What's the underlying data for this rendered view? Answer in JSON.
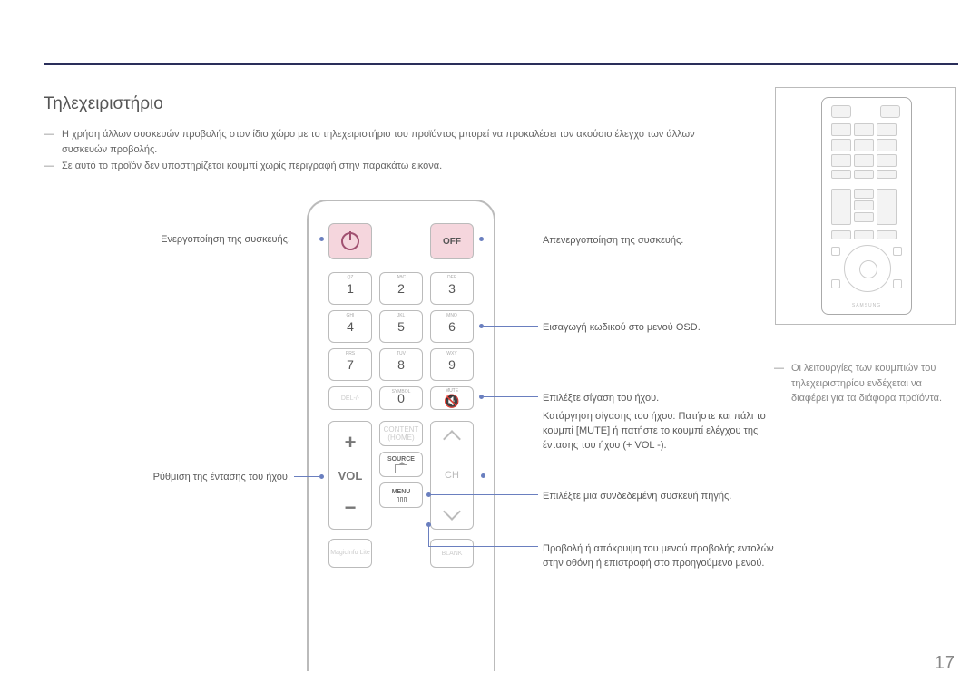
{
  "title": "Τηλεχειριστήριο",
  "notes": {
    "n1": "Η χρήση άλλων συσκευών προβολής στον ίδιο χώρο με το τηλεχειριστήριο του προϊόντος μπορεί να προκαλέσει τον ακούσιο έλεγχο των άλλων συσκευών προβολής.",
    "n2": "Σε αυτό το προϊόν δεν υποστηρίζεται κουμπί χωρίς περιγραφή στην παρακάτω εικόνα."
  },
  "right_note": "Οι λειτουργίες των κουμπιών του τηλεχειριστηρίου ενδέχεται να διαφέρει για τα διάφορα προϊόντα.",
  "left_labels": {
    "power_on": "Ενεργοποίηση της συσκευής.",
    "volume": "Ρύθμιση της έντασης του ήχου."
  },
  "right_labels": {
    "power_off": "Απενεργοποίηση της συσκευής.",
    "osd_code": "Εισαγωγή κωδικού στο μενού OSD.",
    "mute": "Επιλέξτε σίγαση του ήχου.",
    "unmute": "Κατάργηση σίγασης του ήχου: Πατήστε και πάλι το κουμπί [MUTE] ή πατήστε το κουμπί ελέγχου της έντασης του ήχου (+ VOL -).",
    "source": "Επιλέξτε μια συνδεδεμένη συσκευή πηγής.",
    "menu": "Προβολή ή απόκρυψη του μενού προβολής εντολών στην οθόνη ή επιστροφή στο προηγούμενο μενού."
  },
  "remote": {
    "off": "OFF",
    "vol": "VOL",
    "ch": "CH",
    "plus": "+",
    "minus": "−",
    "numbers": [
      "1",
      "2",
      "3",
      "4",
      "5",
      "6",
      "7",
      "8",
      "9",
      "0"
    ],
    "numlabels": [
      "QZ",
      "ABC",
      "DEF",
      "GHI",
      "JKL",
      "MNO",
      "PRS",
      "TUV",
      "WXY"
    ],
    "del": "DEL-/-",
    "symbol": "SYMBOL",
    "mute": "MUTE",
    "content": "CONTENT",
    "home": "(HOME)",
    "source": "SOURCE",
    "menu": "MENU",
    "blank": "BLANK",
    "magic": "MagicInfo Lite",
    "brand": "SAMSUNG"
  },
  "page": "17"
}
